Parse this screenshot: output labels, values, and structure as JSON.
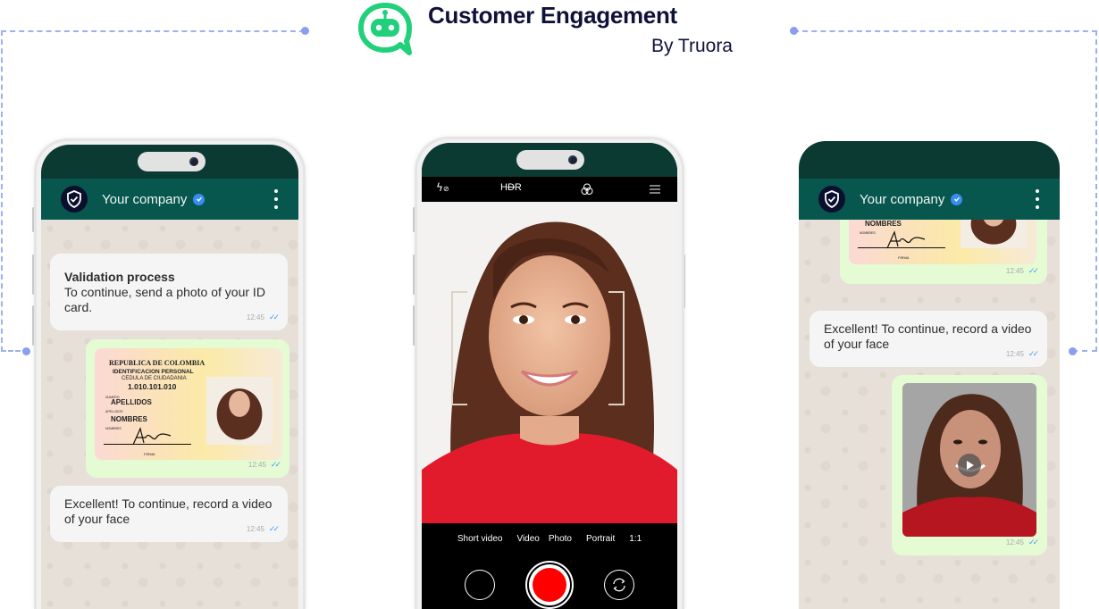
{
  "header": {
    "title": "Customer Engagement",
    "subtitle": "By Truora",
    "logo_icon": "chat-robot-icon",
    "brand_color": "#21d07a"
  },
  "colors": {
    "whatsapp_header": "#07574e",
    "status_bar": "#0b3a33",
    "incoming_bubble": "#f5f5f5",
    "outgoing_bubble": "#e5fbd4",
    "record_button": "#ff0000",
    "dashed_connector": "#9fb0ef"
  },
  "phone_left": {
    "contact_name": "Your company",
    "verified_icon": "verified-badge-icon",
    "menu_icon": "kebab-menu-icon",
    "messages": [
      {
        "direction": "incoming",
        "title": "Validation process",
        "text": "To continue, send a photo of your ID card.",
        "time": "12:45",
        "status": "read"
      },
      {
        "direction": "outgoing",
        "type": "id-card-image",
        "time": "12:45",
        "status": "read"
      },
      {
        "direction": "incoming",
        "text": "Excellent! To continue, record a video of your face",
        "time": "12:45",
        "status": "read"
      }
    ]
  },
  "id_card": {
    "country": "REPUBLICA DE COLOMBIA",
    "doc_type": "IDENTIFICACION PERSONAL",
    "doc_subtype": "CEDULA DE CIUDADANIA",
    "number": "1.010.101.010",
    "number_label": "NUMERO",
    "surname": "APELLIDOS",
    "surname_label": "APELLIDOS",
    "names": "NOMBRES",
    "names_label": "NOMBRES",
    "signature_label": "FIRMA"
  },
  "phone_center": {
    "top_controls": [
      {
        "icon": "flash-off-icon",
        "label": "ϟ⊘"
      },
      {
        "icon": "hdr-off-icon",
        "label": "HDR"
      },
      {
        "icon": "filters-icon",
        "label": ""
      },
      {
        "icon": "menu-icon",
        "label": ""
      }
    ],
    "modes": [
      "Short video",
      "Video",
      "Photo",
      "Portrait",
      "1:1"
    ],
    "buttons": {
      "gallery": "gallery-thumbnail-button",
      "record": "record-button",
      "switch_camera": "switch-camera-button"
    }
  },
  "phone_right": {
    "contact_name": "Your company",
    "messages": [
      {
        "direction": "outgoing",
        "type": "id-card-image",
        "time": "12:45",
        "status": "read"
      },
      {
        "direction": "incoming",
        "text": "Excellent! To continue, record a video of your face",
        "time": "12:45",
        "status": "read"
      },
      {
        "direction": "outgoing",
        "type": "video",
        "time": "12:45",
        "status": "read"
      }
    ]
  }
}
